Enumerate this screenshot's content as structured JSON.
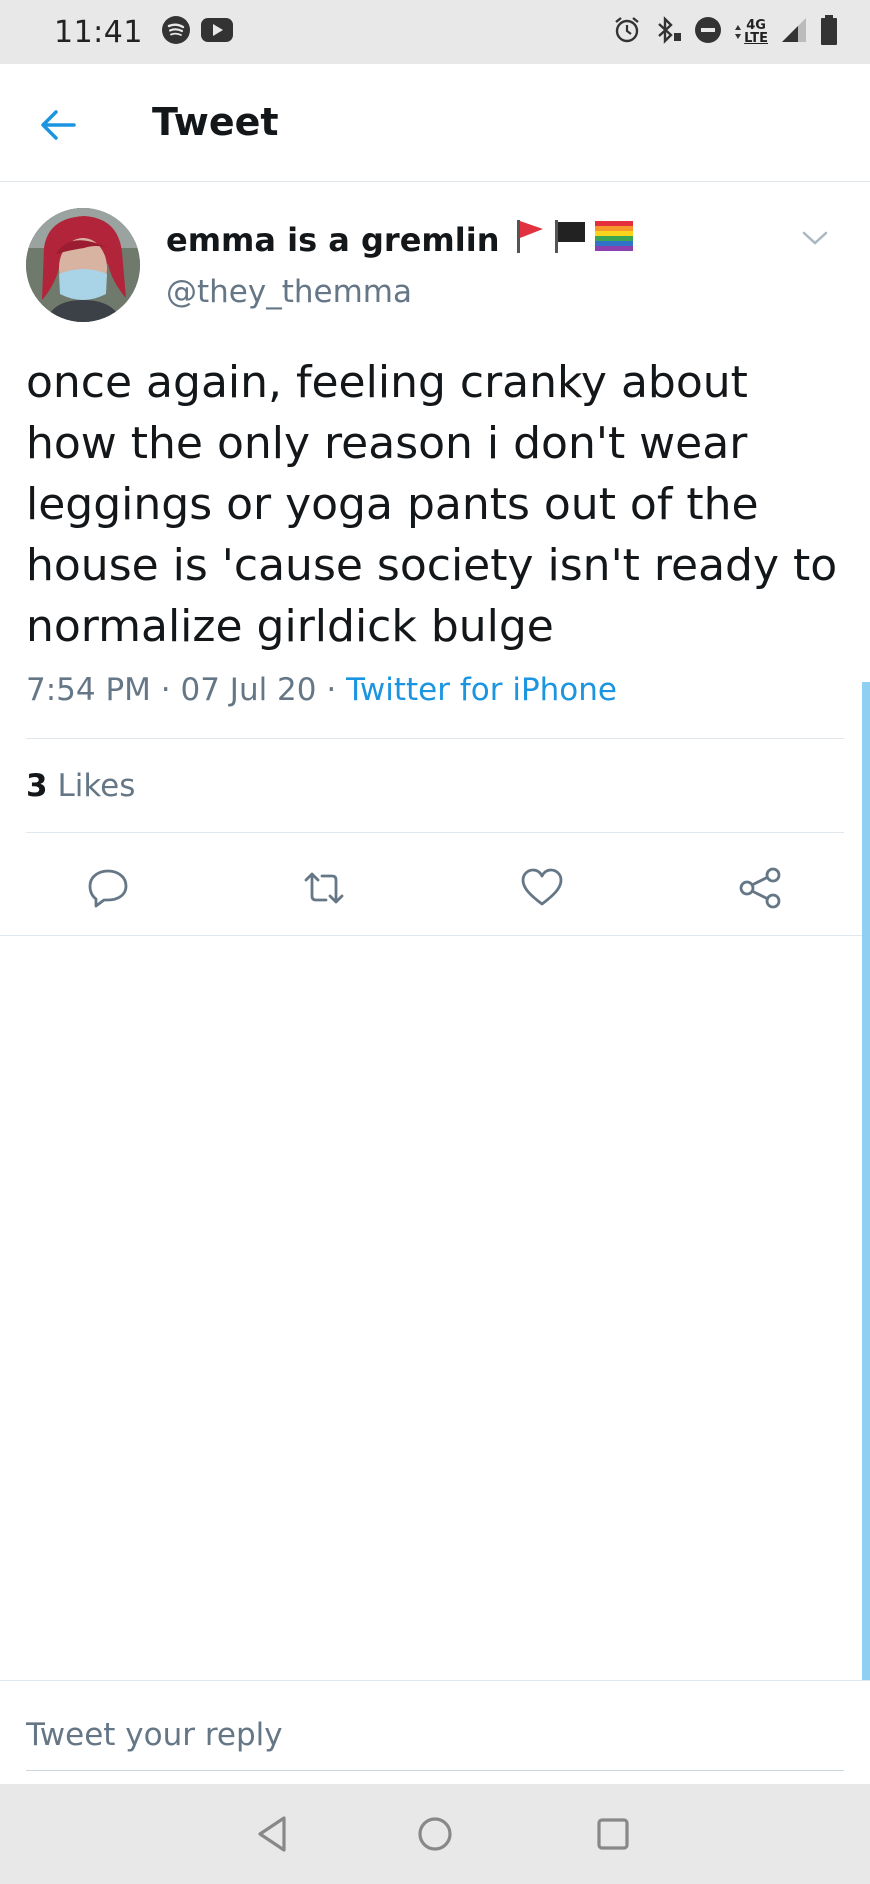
{
  "status_bar": {
    "time": "11:41",
    "network": "4G",
    "network_sub": "LTE",
    "left_icons": [
      "spotify-icon",
      "youtube-icon"
    ],
    "right_icons": [
      "alarm-icon",
      "bluetooth-icon",
      "do-not-disturb-icon",
      "signal-icon",
      "battery-icon"
    ]
  },
  "header": {
    "title": "Tweet",
    "back_icon": "arrow-left-icon"
  },
  "tweet": {
    "author_name": "emma is a gremlin",
    "flags": [
      "red-flag",
      "black-flag",
      "rainbow-flag"
    ],
    "handle": "@they_themma",
    "text": "once again, feeling cranky about how the only reason i don't wear leggings or yoga pants out of the house is 'cause society isn't ready to normalize girldick bulge",
    "time": "7:54 PM",
    "date": "07 Jul 20",
    "separator": "·",
    "source": "Twitter for iPhone",
    "likes_count": "3",
    "likes_label": "Likes"
  },
  "actions": [
    "reply-icon",
    "retweet-icon",
    "like-icon",
    "share-icon"
  ],
  "reply": {
    "placeholder": "Tweet your reply"
  },
  "nav": [
    "back-icon",
    "home-icon",
    "recents-icon"
  ],
  "colors": {
    "accent": "#1b95e0",
    "secondary_text": "#657786",
    "primary_text": "#14171a",
    "system_bar": "#e8e8e8"
  }
}
